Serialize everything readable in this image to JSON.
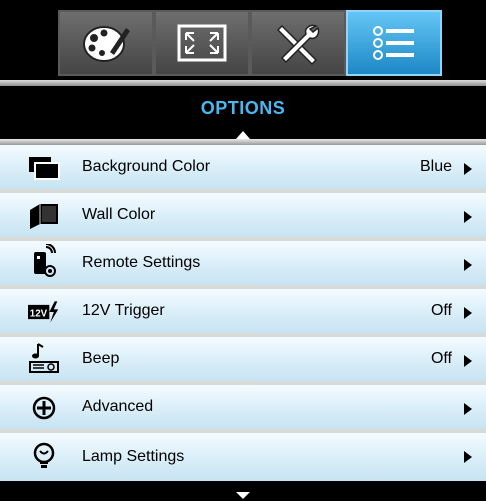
{
  "header": {
    "title": "OPTIONS"
  },
  "tabs": [
    {
      "icon": "palette-icon",
      "active": false
    },
    {
      "icon": "screen-resize-icon",
      "active": false
    },
    {
      "icon": "tools-icon",
      "active": false
    },
    {
      "icon": "list-menu-icon",
      "active": true
    }
  ],
  "menu": {
    "items": [
      {
        "label": "Background Color",
        "value": "Blue",
        "icon": "background-color-icon"
      },
      {
        "label": "Wall Color",
        "value": "",
        "icon": "wall-color-icon"
      },
      {
        "label": "Remote Settings",
        "value": "",
        "icon": "remote-settings-icon"
      },
      {
        "label": "12V Trigger",
        "value": "Off",
        "icon": "trigger-12v-icon"
      },
      {
        "label": "Beep",
        "value": "Off",
        "icon": "beep-icon"
      },
      {
        "label": "Advanced",
        "value": "",
        "icon": "advanced-icon"
      },
      {
        "label": "Lamp Settings",
        "value": "",
        "icon": "lamp-settings-icon"
      }
    ]
  },
  "colors": {
    "accent": "#49b8f0",
    "active_tab": "#2a9ad8",
    "row_top": "#f4fbff",
    "row_bottom": "#c7e3f2"
  }
}
